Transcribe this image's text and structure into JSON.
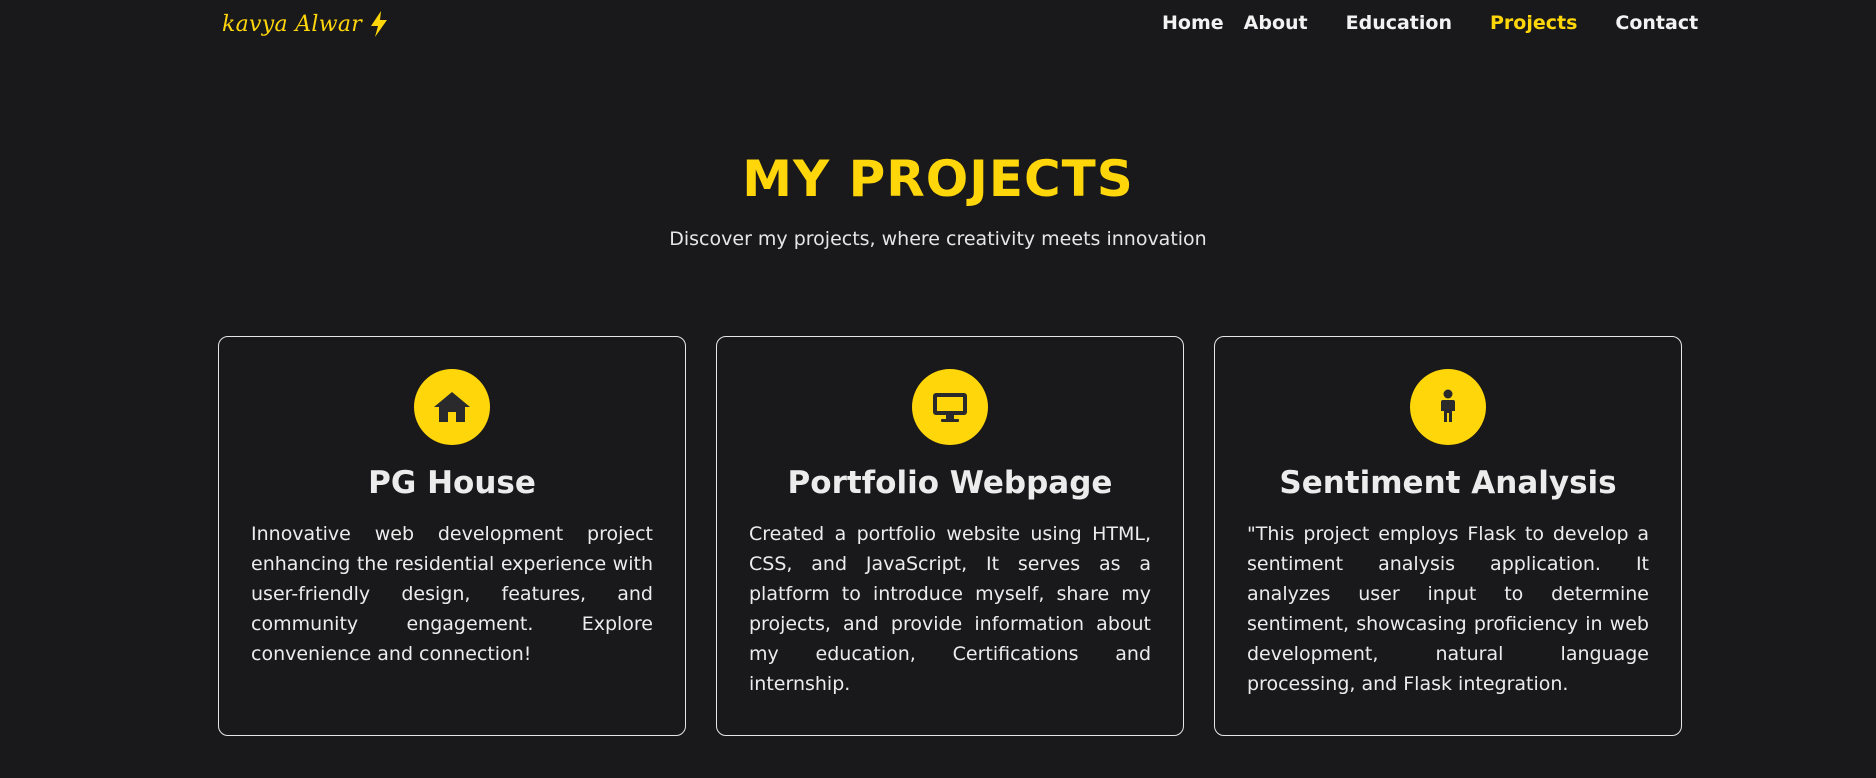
{
  "brand": {
    "name": "kavya Alwar",
    "accent_color": "#ffd60a",
    "icon": "lightning-bolt-icon"
  },
  "nav": {
    "items": [
      {
        "label": "Home",
        "active": false
      },
      {
        "label": "About",
        "active": false
      },
      {
        "label": "Education",
        "active": false
      },
      {
        "label": "Projects",
        "active": true
      },
      {
        "label": "Contact",
        "active": false
      }
    ]
  },
  "hero": {
    "title": "MY PROJECTS",
    "subtitle": "Discover my projects, where creativity meets innovation"
  },
  "projects": [
    {
      "icon": "house-icon",
      "title": "PG House",
      "description": "Innovative web development project enhancing the residential experience with user-friendly design, features, and community engagement. Explore convenience and connection!"
    },
    {
      "icon": "desktop-monitor-icon",
      "title": "Portfolio Webpage",
      "description": "Created a portfolio website using HTML, CSS, and JavaScript, It serves as a platform to introduce myself, share my projects, and provide information about my education, Certifications and internship."
    },
    {
      "icon": "person-icon",
      "title": "Sentiment Analysis",
      "description": "\"This project employs Flask to develop a sentiment analysis application. It analyzes user input to determine sentiment, showcasing proficiency in web development, natural language processing, and Flask integration."
    }
  ]
}
